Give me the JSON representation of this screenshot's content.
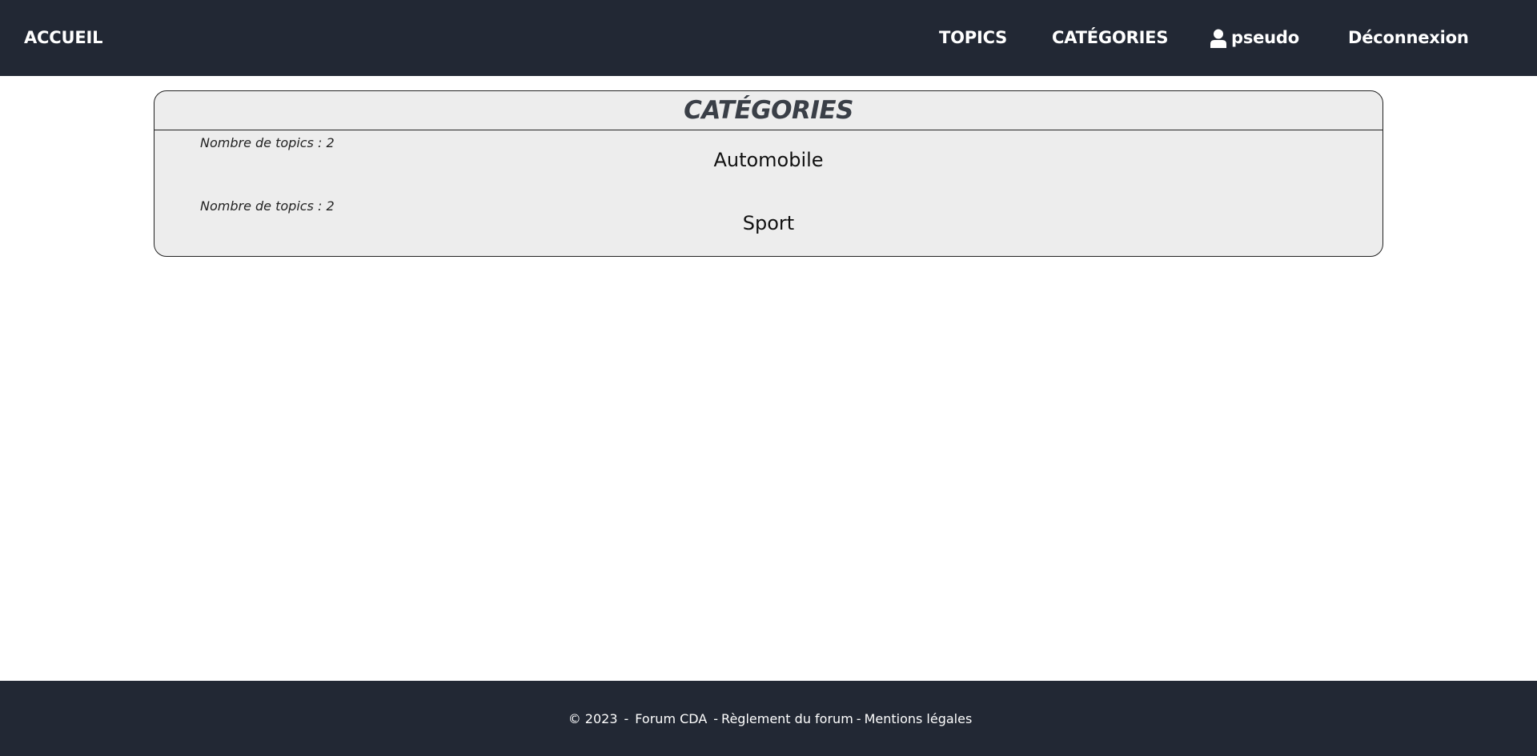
{
  "nav": {
    "home_label": "ACCUEIL",
    "topics_label": "TOPICS",
    "categories_label": "CATÉGORIES",
    "user_icon": "user-icon",
    "username": "pseudo",
    "logout_label": "Déconnexion"
  },
  "colors": {
    "navbar_bg": "#222834",
    "panel_bg": "#ededed",
    "title_color": "#3a3f47"
  },
  "panel": {
    "title": "CATÉGORIES",
    "categories": [
      {
        "count_text": "Nombre de topics : 2",
        "name": "Automobile"
      },
      {
        "count_text": "Nombre de topics : 2",
        "name": "Sport"
      }
    ]
  },
  "footer": {
    "copyright": "© 2023",
    "sep": "-",
    "site_name": "Forum CDA",
    "rules_label": "Règlement du forum",
    "legal_label": "Mentions légales"
  }
}
